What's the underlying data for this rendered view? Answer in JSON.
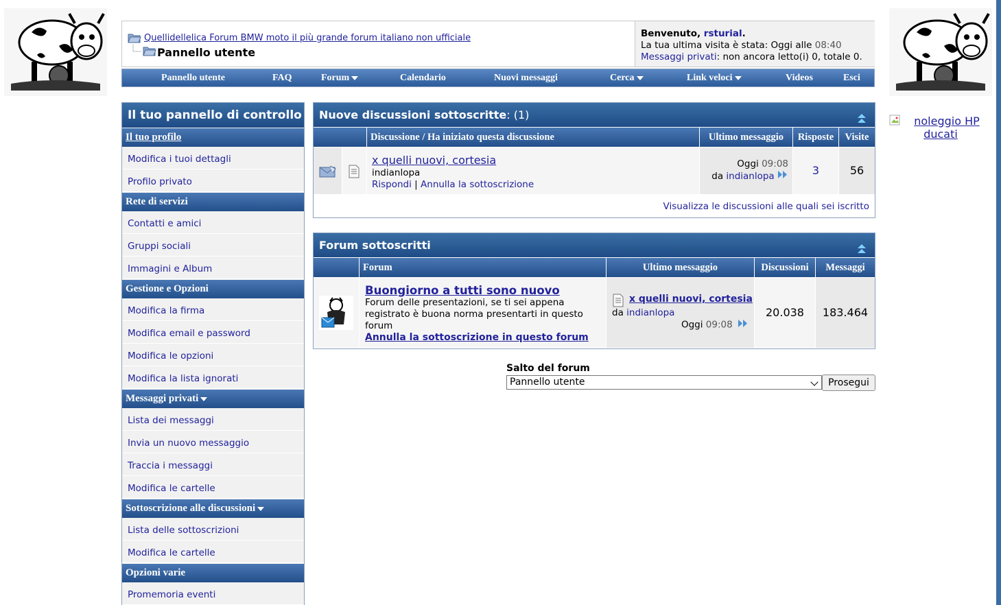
{
  "breadcrumb": {
    "forum_link": "Quellidellelica Forum BMW moto il più grande forum italiano non ufficiale",
    "current": "Pannello utente"
  },
  "welcome": {
    "prefix": "Benvenuto, ",
    "username": "rsturial",
    "suffix": ".",
    "last_visit_label": "La tua ultima visita è stata: Oggi alle ",
    "last_visit_time": "08:40",
    "pm_link": "Messaggi privati",
    "pm_status": ": non ancora letto(i) 0, totale 0."
  },
  "navbar": [
    {
      "label": "Pannello utente",
      "dropdown": false
    },
    {
      "label": "FAQ",
      "dropdown": false
    },
    {
      "label": "Forum",
      "dropdown": true
    },
    {
      "label": "Calendario",
      "dropdown": false
    },
    {
      "label": "Nuovi messaggi",
      "dropdown": false
    },
    {
      "label": "Cerca",
      "dropdown": true
    },
    {
      "label": "Link veloci",
      "dropdown": true
    },
    {
      "label": "Videos",
      "dropdown": false
    },
    {
      "label": "Esci",
      "dropdown": false
    }
  ],
  "sidebar": {
    "title": "Il tuo pannello di controllo",
    "profile_head": "Il tuo profilo",
    "profile_items": [
      "Modifica i tuoi dettagli",
      "Profilo privato"
    ],
    "network_head": "Rete di servizi",
    "network_items": [
      "Contatti e amici",
      "Gruppi sociali",
      "Immagini e Album"
    ],
    "options_head": "Gestione e Opzioni",
    "options_items": [
      "Modifica la firma",
      "Modifica email e password",
      "Modifica le opzioni",
      "Modifica la lista ignorati"
    ],
    "pm_head": "Messaggi privati",
    "pm_items": [
      "Lista dei messaggi",
      "Invia un nuovo messaggio",
      "Traccia i messaggi",
      "Modifica le cartelle"
    ],
    "subs_head": "Sottoscrizione alle discussioni",
    "subs_items": [
      "Lista delle sottoscrizioni",
      "Modifica le cartelle"
    ],
    "misc_head": "Opzioni varie",
    "misc_items": [
      "Promemoria eventi"
    ]
  },
  "threads_block": {
    "title": "Nuove discussioni sottoscritte",
    "count": ": (1)",
    "columns": [
      "Discussione / Ha iniziato questa discussione",
      "Ultimo messaggio",
      "Risposte",
      "Visite"
    ],
    "row": {
      "title": "x quelli nuovi, cortesia",
      "starter": "indianlopa",
      "reply": "Rispondi",
      "separator": "|",
      "unsubscribe": "Annulla la sottoscrizione",
      "last_day": "Oggi",
      "last_time": "09:08",
      "last_by_prefix": "da",
      "last_by": "indianlopa",
      "replies": "3",
      "views": "56"
    },
    "footer_link": "Visualizza le discussioni alle quali sei iscritto"
  },
  "forums_block": {
    "title": "Forum sottoscritti",
    "columns": [
      "Forum",
      "Ultimo messaggio",
      "Discussioni",
      "Messaggi"
    ],
    "row": {
      "name": "Buongiorno a tutti sono nuovo",
      "description": "Forum delle presentazioni, se ti sei appena registrato è buona norma presentarti in questo forum",
      "unsubscribe": "Annulla la sottoscrizione in questo forum",
      "last_thread": "x quelli nuovi, cortesia",
      "last_by_prefix": "da",
      "last_by": "indianlopa",
      "last_day": "Oggi",
      "last_time": "09:08",
      "threads": "20.038",
      "posts": "183.464"
    }
  },
  "jump": {
    "label": "Salto del forum",
    "selected": "Pannello utente",
    "button": "Prosegui"
  },
  "ad": {
    "alt_text_1": "noleggio HP",
    "alt_text_2": "ducati"
  },
  "colors": {
    "header_blue": "#2c5b99",
    "link": "#22229c",
    "row_bg": "#f5f5f5"
  }
}
